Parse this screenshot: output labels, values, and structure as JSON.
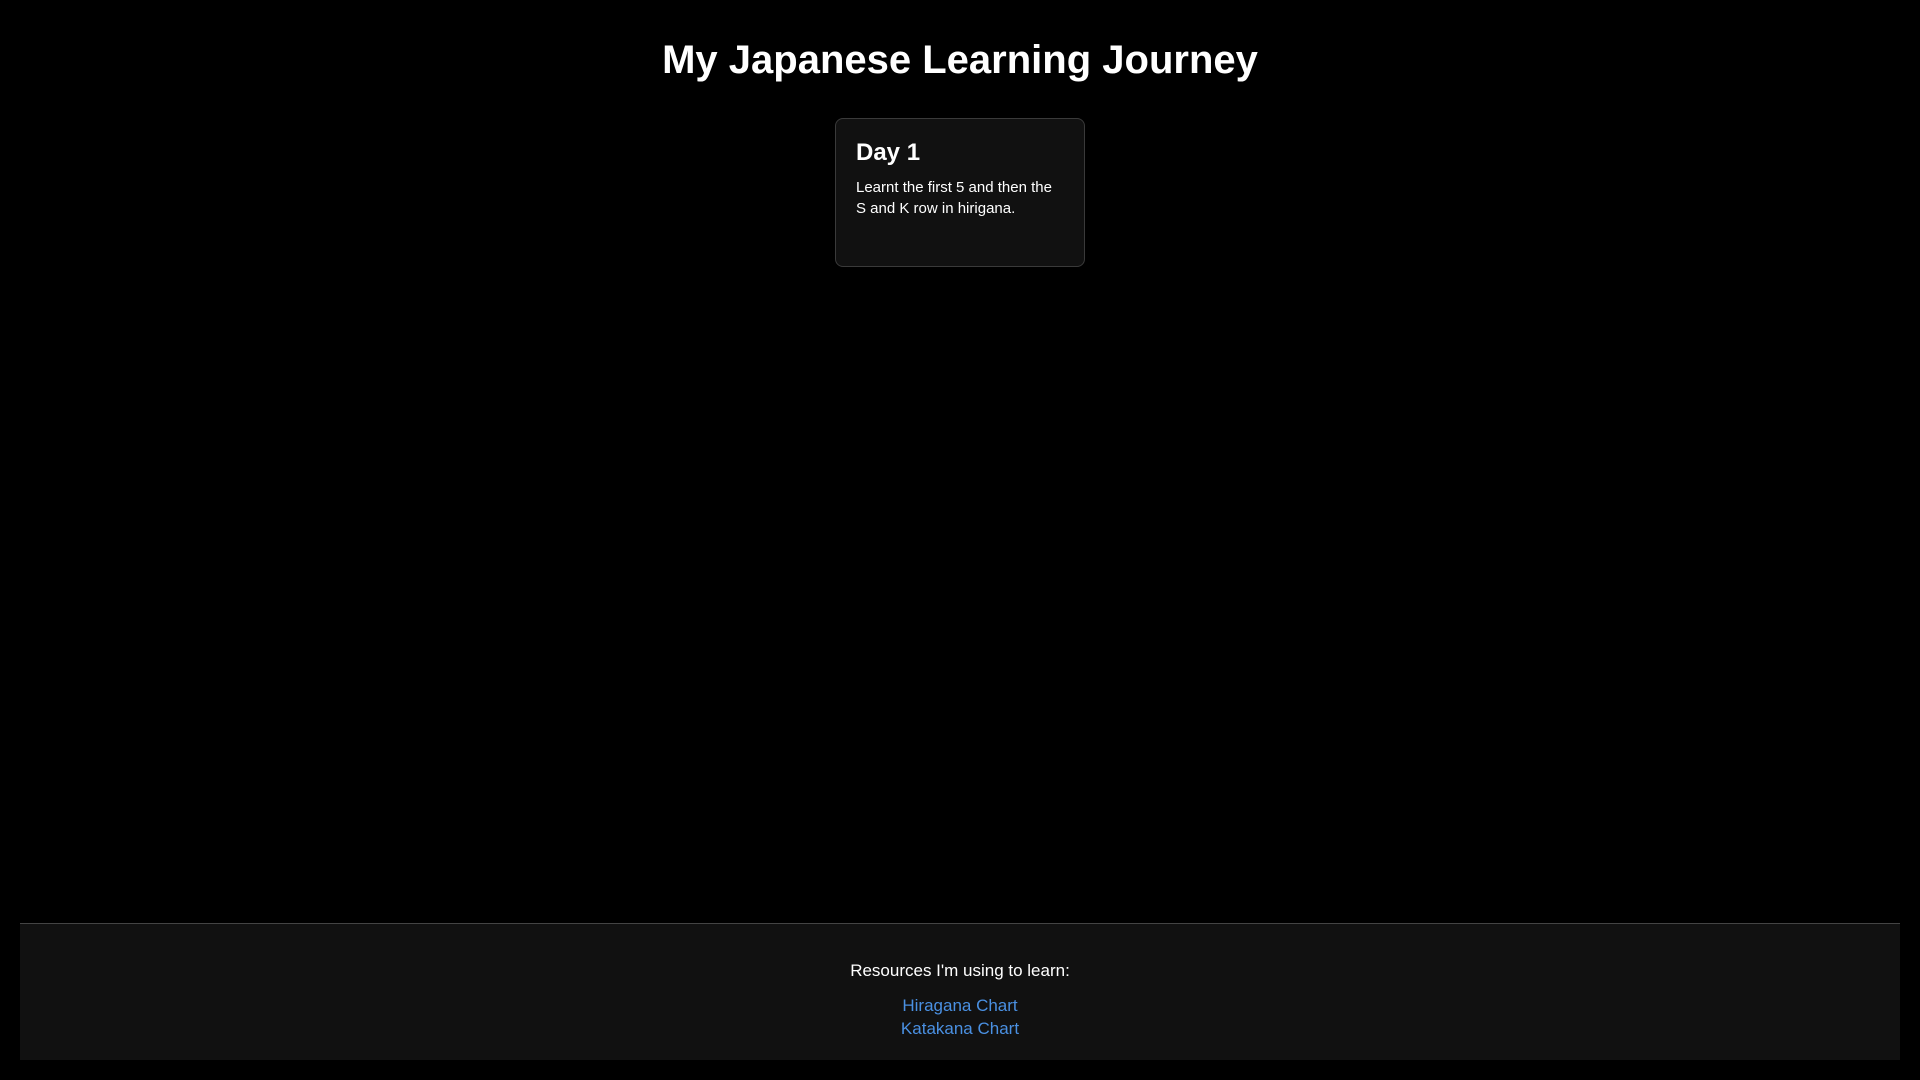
{
  "header": {
    "title": "My Japanese Learning Journey"
  },
  "entries": [
    {
      "title": "Day 1",
      "body": "Learnt the first 5 and then the S and K row in hirigana."
    }
  ],
  "footer": {
    "heading": "Resources I'm using to learn:",
    "links": [
      {
        "label": "Hiragana Chart"
      },
      {
        "label": "Katakana Chart"
      }
    ]
  },
  "colors": {
    "background": "#000000",
    "card_background": "#111111",
    "link": "#4a90e2",
    "text": "#ffffff"
  }
}
